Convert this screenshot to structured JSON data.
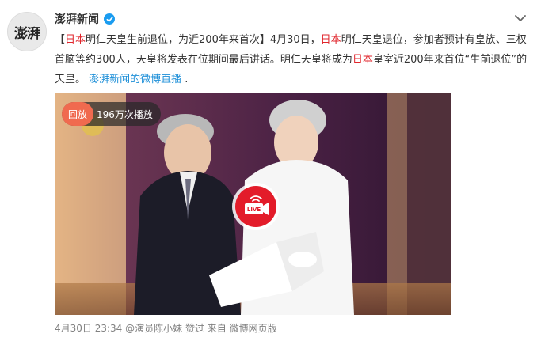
{
  "account": {
    "avatar_text": "澎湃",
    "name": "澎湃新闻",
    "verified_icon": "verified-badge-icon",
    "more_icon": "chevron-down-icon"
  },
  "post": {
    "open_bracket": "【",
    "title_hl": "日本",
    "title_rest": "明仁天皇生前退位，为近200年来首次】4月30日，",
    "body_hl1": "日本",
    "body_seg1": "明仁天皇退位，参加者预计有皇族、三权首脑等约300人，天皇将发表在位期间最后讲话。明仁天皇将成为",
    "body_hl2": "日本",
    "body_seg2": "皇室近200年来首位“生前退位”的天皇。",
    "link_text": "澎湃新闻的微博直播",
    "end": " ."
  },
  "video": {
    "replay_label": "回放",
    "play_count": "196万次播放",
    "live_label": "LIVE"
  },
  "footer": {
    "time": "4月30日 23:34",
    "via": "@演员陈小妹 赞过",
    "source_prefix": "来自",
    "source": "微博网页版"
  },
  "colors": {
    "highlight": "#e0262c",
    "link": "#1d8fd8",
    "replay_pill": "#f06a4f",
    "live_button": "#e31c2a",
    "verified": "#1a9cf0"
  }
}
